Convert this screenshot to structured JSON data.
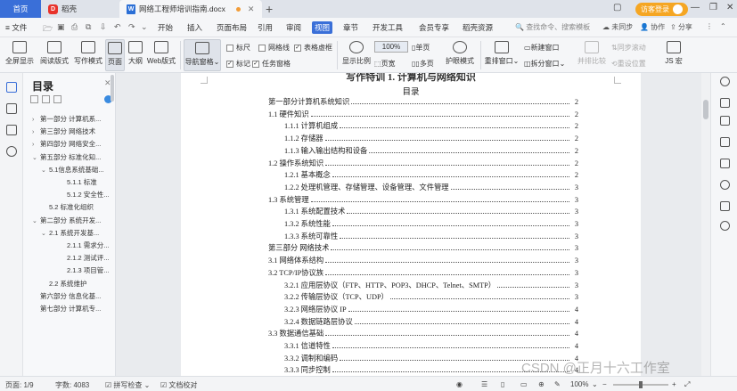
{
  "tabs": {
    "home": "首页",
    "wps": "稻壳",
    "document": "网络工程师培训指南.docx",
    "visitor_login": "访客登录"
  },
  "menu": {
    "file": "文件",
    "items": [
      "开始",
      "插入",
      "页面布局",
      "引用",
      "审阅",
      "视图",
      "章节",
      "开发工具",
      "会员专享",
      "稻壳资源"
    ],
    "active_index": 5,
    "search_placeholder": "查找命令、搜索模板",
    "sync": "未同步",
    "collab": "协作",
    "share": "分享"
  },
  "ribbon": {
    "buttons": [
      "全屏显示",
      "阅读版式",
      "写作模式",
      "页面",
      "大纲",
      "Web版式",
      "导航窗格"
    ],
    "checks": [
      {
        "label": "标尺",
        "checked": false
      },
      {
        "label": "网格线",
        "checked": false
      },
      {
        "label": "表格虚框",
        "checked": true
      },
      {
        "label": "标记",
        "checked": true
      },
      {
        "label": "任务窗格",
        "checked": true
      }
    ],
    "zoom_label": "显示比例",
    "zoom_value": "100%",
    "single_page": "单页",
    "multi_page": "多页",
    "page_width": "页宽",
    "eye_mode": "护眼模式",
    "rearrange": "重排窗口",
    "new_window": "新建窗口",
    "split_window": "拆分窗口",
    "side_compare": "并排比较",
    "sync_scroll": "同步滚动",
    "reset_pos": "重设位置",
    "js_macro": "JS 宏"
  },
  "nav": {
    "title": "目录",
    "items": [
      {
        "label": "第一部分 计算机系...",
        "level": 0,
        "arrow": "›"
      },
      {
        "label": "第三部分 网络技术",
        "level": 0,
        "arrow": "›"
      },
      {
        "label": "第四部分 网络安全...",
        "level": 0,
        "arrow": "›"
      },
      {
        "label": "第五部分 标准化知...",
        "level": 0,
        "arrow": "⌄"
      },
      {
        "label": "5.1信息系统基础...",
        "level": 1,
        "arrow": "⌄"
      },
      {
        "label": "5.1.1 标准",
        "level": 2,
        "arrow": ""
      },
      {
        "label": "5.1.2 安全性...",
        "level": 2,
        "arrow": ""
      },
      {
        "label": "5.2 标准化组织",
        "level": 1,
        "arrow": ""
      },
      {
        "label": "第二部分 系统开发...",
        "level": 0,
        "arrow": "⌄"
      },
      {
        "label": "2.1 系统开发基...",
        "level": 1,
        "arrow": "⌄"
      },
      {
        "label": "2.1.1 需求分...",
        "level": 2,
        "arrow": ""
      },
      {
        "label": "2.1.2 测试评...",
        "level": 2,
        "arrow": ""
      },
      {
        "label": "2.1.3 项目管...",
        "level": 2,
        "arrow": ""
      },
      {
        "label": "2.2 系统维护",
        "level": 1,
        "arrow": ""
      },
      {
        "label": "第六部分 信息化基...",
        "level": 0,
        "arrow": ""
      },
      {
        "label": "第七部分 计算机专...",
        "level": 0,
        "arrow": ""
      }
    ]
  },
  "document": {
    "header_partial": "写作特训 1. 计算机与网络知识",
    "toc_title": "目录",
    "toc": [
      {
        "text": "第一部分计算机系统知识",
        "page": "2",
        "level": 0
      },
      {
        "text": "1.1 硬件知识",
        "page": "2",
        "level": 0
      },
      {
        "text": "1.1.1 计算机组成",
        "page": "2",
        "level": 2
      },
      {
        "text": "1.1.2 存储器",
        "page": "2",
        "level": 2
      },
      {
        "text": "1.1.3 输入输出结构和设备",
        "page": "2",
        "level": 2
      },
      {
        "text": "1.2 操作系统知识",
        "page": "2",
        "level": 0
      },
      {
        "text": "1.2.1 基本概念",
        "page": "2",
        "level": 2
      },
      {
        "text": "1.2.2 处理机管理、存储管理、设备管理、文件管理",
        "page": "3",
        "level": 2
      },
      {
        "text": "1.3 系统管理",
        "page": "3",
        "level": 0
      },
      {
        "text": "1.3.1 系统配置技术",
        "page": "3",
        "level": 2
      },
      {
        "text": "1.3.2 系统性能",
        "page": "3",
        "level": 2
      },
      {
        "text": "1.3.3 系统可靠性",
        "page": "3",
        "level": 2
      },
      {
        "text": "第三部分 网络技术",
        "page": "3",
        "level": 0
      },
      {
        "text": "3.1 网络体系结构",
        "page": "3",
        "level": 0
      },
      {
        "text": "3.2 TCP/IP协议族",
        "page": "3",
        "level": 0
      },
      {
        "text": "3.2.1 应用层协议（FTP、HTTP、POP3、DHCP、Telnet、SMTP）",
        "page": "3",
        "level": 2
      },
      {
        "text": "3.2.2 传输层协议（TCP、UDP）",
        "page": "3",
        "level": 2
      },
      {
        "text": "3.2.3 网络层协议 IP",
        "page": "4",
        "level": 2
      },
      {
        "text": "3.2.4 数据链路层协议",
        "page": "4",
        "level": 2
      },
      {
        "text": "3.3 数据通信基础",
        "page": "4",
        "level": 0
      },
      {
        "text": "3.3.1 信道特性",
        "page": "4",
        "level": 2
      },
      {
        "text": "3.3.2 调制和编码",
        "page": "4",
        "level": 2
      },
      {
        "text": "3.3.3 同步控制",
        "page": "4",
        "level": 2
      }
    ]
  },
  "status": {
    "page": "页面: 1/9",
    "words": "字数: 4083",
    "spellcheck": "拼写检查",
    "proofread": "文档校对",
    "zoom": "100%",
    "zoom_fraction": 0.5
  },
  "watermark": "CSDN @正月十六工作室"
}
